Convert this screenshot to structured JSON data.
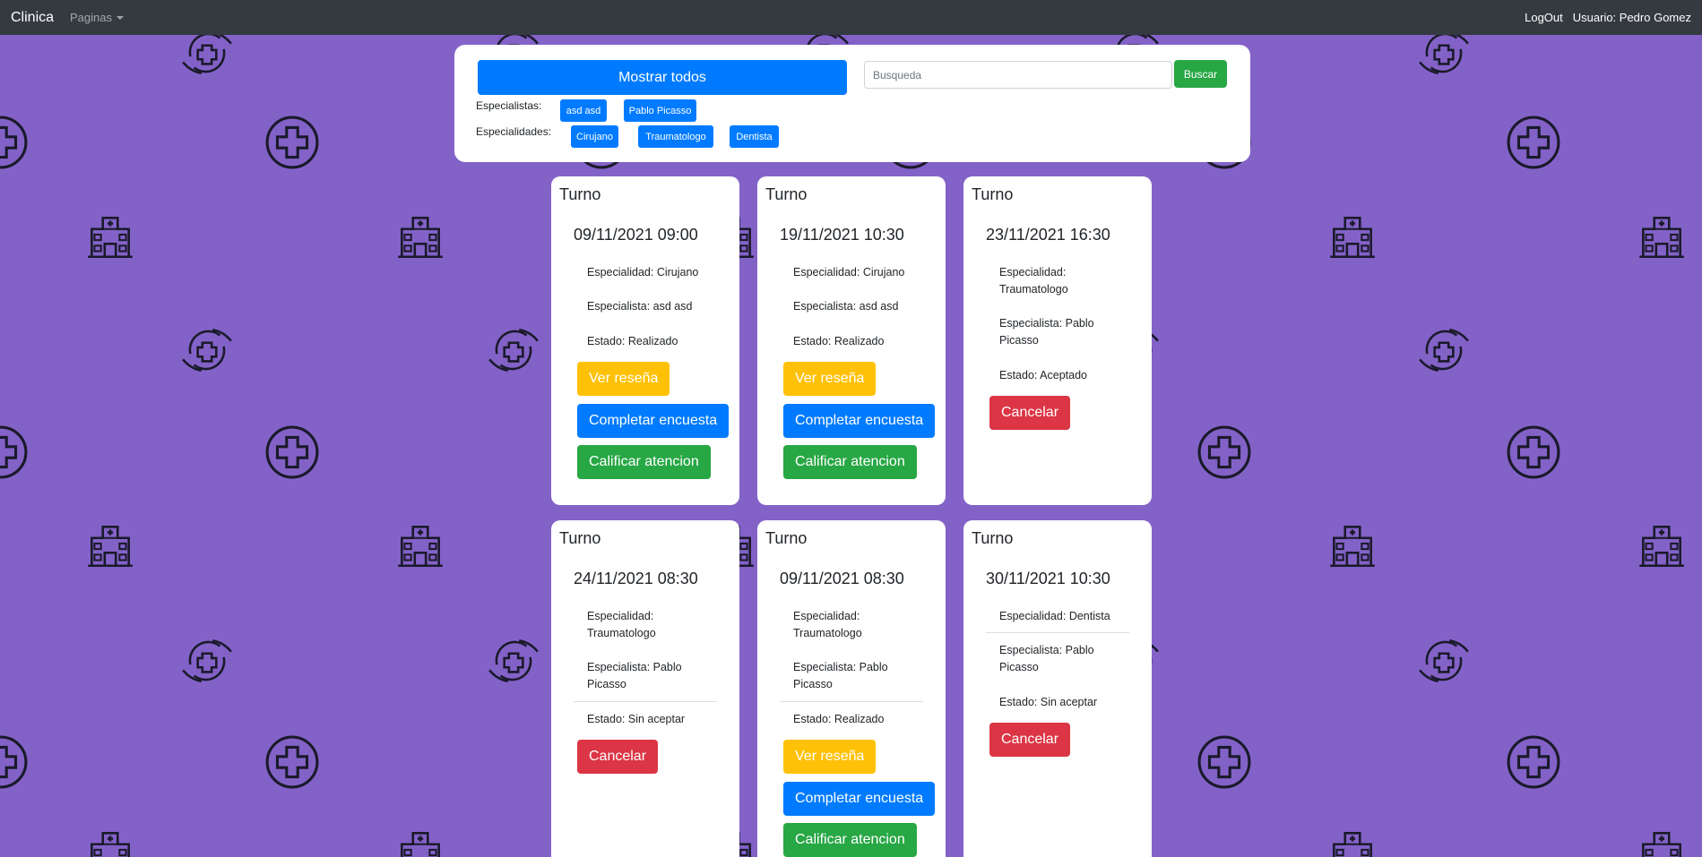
{
  "colors": {
    "background": "#8362c8",
    "navbar": "#343a40",
    "primary": "#007bff",
    "success": "#28a745",
    "warning": "#ffc107",
    "danger": "#dc3545"
  },
  "navbar": {
    "brand": "Clinica",
    "pages_menu": "Paginas",
    "logout": "LogOut",
    "user": "Usuario: Pedro Gomez"
  },
  "filters": {
    "show_all": "Mostrar todos",
    "search_placeholder": "Busqueda",
    "search_button": "Buscar",
    "specialists_label": "Especialistas:",
    "specialists": [
      "asd asd",
      "Pablo Picasso"
    ],
    "specialties_label": "Especialidades:",
    "specialties": [
      "Cirujano",
      "Traumatologo",
      "Dentista"
    ]
  },
  "cards": [
    {
      "title": "Turno",
      "date": "09/11/2021 09:00",
      "especialidad": "Especialidad: Cirujano",
      "especialista": "Especialista: asd asd",
      "estado": "Estado: Realizado",
      "buttons": [
        "Ver reseña",
        "Completar encuesta",
        "Calificar atencion"
      ]
    },
    {
      "title": "Turno",
      "date": "19/11/2021 10:30",
      "especialidad": "Especialidad: Cirujano",
      "especialista": "Especialista: asd asd",
      "estado": "Estado: Realizado",
      "buttons": [
        "Ver reseña",
        "Completar encuesta",
        "Calificar atencion"
      ]
    },
    {
      "title": "Turno",
      "date": "23/11/2021 16:30",
      "especialidad": "Especialidad: Traumatologo",
      "especialista": "Especialista: Pablo Picasso",
      "estado": "Estado: Aceptado",
      "buttons": [
        "Cancelar"
      ]
    },
    {
      "title": "Turno",
      "date": "24/11/2021 08:30",
      "especialidad": "Especialidad: Traumatologo",
      "especialista": "Especialista: Pablo Picasso",
      "estado": "Estado: Sin aceptar",
      "buttons": [
        "Cancelar"
      ]
    },
    {
      "title": "Turno",
      "date": "09/11/2021 08:30",
      "especialidad": "Especialidad: Traumatologo",
      "especialista": "Especialista: Pablo Picasso",
      "estado": "Estado: Realizado",
      "buttons": [
        "Ver reseña",
        "Completar encuesta",
        "Calificar atencion"
      ]
    },
    {
      "title": "Turno",
      "date": "30/11/2021 10:30",
      "especialidad": "Especialidad: Dentista",
      "especialista": "Especialista: Pablo Picasso",
      "estado": "Estado: Sin aceptar",
      "buttons": [
        "Cancelar"
      ]
    }
  ]
}
